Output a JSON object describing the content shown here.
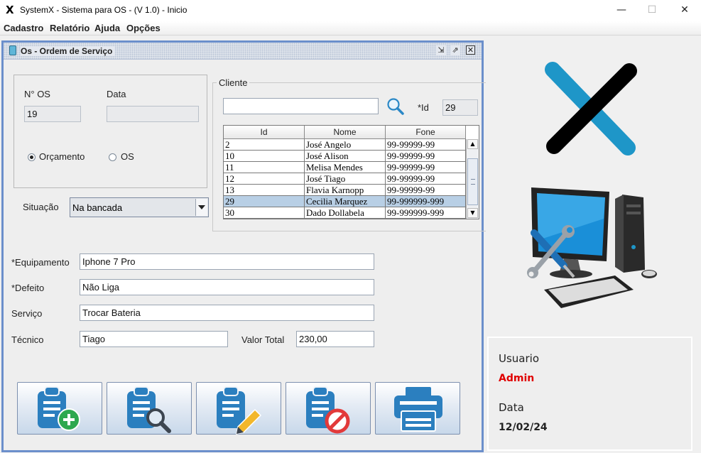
{
  "window": {
    "title": "SystemX - Sistema para OS - (V 1.0) - Inicio",
    "app_icon": "X",
    "minimize": "—",
    "maximize": "☐",
    "close": "✕"
  },
  "menu": [
    "Cadastro",
    "Relatório",
    "Ajuda",
    "Opções"
  ],
  "os_frame": {
    "title": "Os - Ordem de Serviço",
    "labels": {
      "numero": "N° OS",
      "data": "Data",
      "orcamento": "Orçamento",
      "os": "OS",
      "situacao": "Situação",
      "cliente": "Cliente",
      "id": "*Id",
      "equipamento": "*Equipamento",
      "defeito": "*Defeito",
      "servico": "Serviço",
      "tecnico": "Técnico",
      "valor_total": "Valor Total"
    },
    "values": {
      "numero": "19",
      "data": "",
      "tipo_selected": "Orçamento",
      "situacao": "Na bancada",
      "cliente_search": "",
      "id": "29",
      "equipamento": "Iphone 7 Pro",
      "defeito": "Não Liga",
      "servico": "Trocar Bateria",
      "tecnico": "Tiago",
      "valor_total": "230,00"
    },
    "table": {
      "columns": [
        "Id",
        "Nome",
        "Fone"
      ],
      "rows": [
        [
          "2",
          "José Angelo",
          "99-99999-99"
        ],
        [
          "10",
          "José Alison",
          "99-99999-99"
        ],
        [
          "11",
          "Melisa Mendes",
          "99-99999-99"
        ],
        [
          "12",
          "José Tiago",
          "99-99999-99"
        ],
        [
          "13",
          "Flavia Karnopp",
          "99-99999-99"
        ],
        [
          "29",
          "Cecilia Marquez",
          "99-999999-999"
        ],
        [
          "30",
          "Dado Dollabela",
          "99-999999-999"
        ]
      ],
      "selected_row": 5
    },
    "buttons": [
      "add-os",
      "search-os",
      "edit-os",
      "delete-os",
      "print-os"
    ]
  },
  "user_panel": {
    "usuario_label": "Usuario",
    "usuario_value": "Admin",
    "data_label": "Data",
    "data_value": "12/02/24"
  },
  "colors": {
    "frame_border": "#6b8fcb",
    "admin_text": "#e00000",
    "logo_blue": "#1e96c8",
    "icon_blue": "#2b7fbf",
    "add_green": "#2ea84f",
    "delete_red": "#e23a3a",
    "edit_yellow": "#f2b72b"
  }
}
